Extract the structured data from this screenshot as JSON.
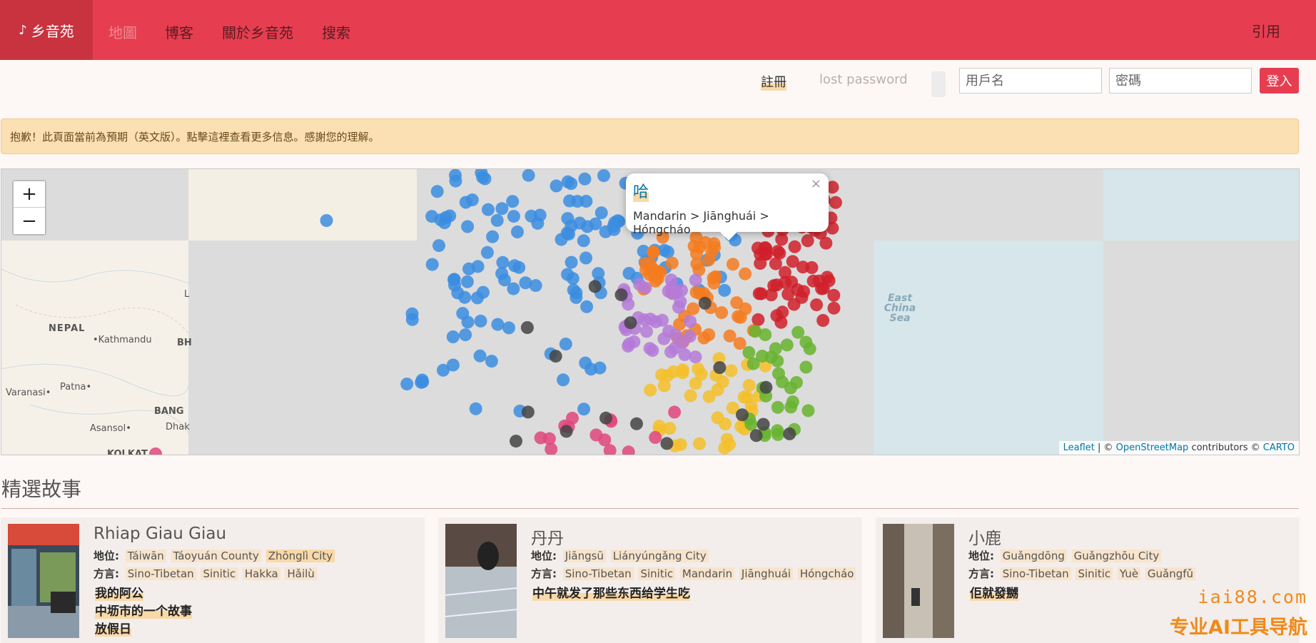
{
  "nav": {
    "brand": "乡音苑",
    "brand_icon": "music-note-icon",
    "links": [
      "地圖",
      "博客",
      "關於乡音苑",
      "搜索"
    ],
    "cite": "引用"
  },
  "login": {
    "register": "註冊",
    "lost_password": "lost password",
    "username_placeholder": "用戶名",
    "password_placeholder": "密碼",
    "submit": "登入"
  },
  "alert": {
    "text": "抱歉！此頁面當前為預期（英文版）。點擊這裡查看更多信息。感謝您的理解。"
  },
  "map": {
    "zoom_in": "+",
    "zoom_out": "−",
    "popup": {
      "title": "哈",
      "path": "Mandarin > Jiānghuái > Hóngcháo",
      "close": "×"
    },
    "attribution": {
      "leaflet": "Leaflet",
      "sep": " | © ",
      "osm": "OpenStreetMap",
      "contrib": " contributors © ",
      "carto": "CARTO"
    },
    "labels": {
      "nepal": "NEPAL",
      "kathmandu": "•Kathmandu",
      "patna": "Patna•",
      "varanasi": "Varanasi•",
      "bang": "BANG",
      "asansol": "Asansol•",
      "dhak": "Dhak",
      "kolkata": "KOLKAT",
      "l": "L",
      "bh": "BH",
      "east_china_sea": "East China Sea"
    },
    "colors": {
      "mandarin": "#3b8de0",
      "wu": "#f47b20",
      "min": "#d0202a",
      "yue": "#f5bf2a",
      "hakka": "#66b32e",
      "gan": "#b57ad8",
      "other": "#444444",
      "tibetan": "#e0467c"
    }
  },
  "featured": {
    "title": "精選故事",
    "location_label": "地位:",
    "dialect_label": "方言:",
    "cards": [
      {
        "name": "Rhiap Giau Giau",
        "location": [
          "Táiwān",
          "Táoyuán County",
          "Zhōnglì City"
        ],
        "dialect": [
          "Sino-Tibetan",
          "Sinitic",
          "Hakka",
          "Hǎilù"
        ],
        "stories": [
          "我的阿公",
          "中坜市的一个故事",
          "放假日"
        ]
      },
      {
        "name": "丹丹",
        "location": [
          "Jiāngsū",
          "Liányúngǎng City"
        ],
        "dialect": [
          "Sino-Tibetan",
          "Sinitic",
          "Mandarin",
          "Jiānghuái",
          "Hóngcháo"
        ],
        "stories": [
          "中午就发了那些东西给学生吃"
        ]
      },
      {
        "name": "小鹿",
        "location": [
          "Guǎngdōng",
          "Guǎngzhōu City"
        ],
        "dialect": [
          "Sino-Tibetan",
          "Sinitic",
          "Yuè",
          "Guǎngfǔ"
        ],
        "stories": [
          "佢就發嬲"
        ]
      }
    ]
  },
  "watermark": {
    "line1": "iai88.com",
    "line2": "专业AI工具导航"
  }
}
